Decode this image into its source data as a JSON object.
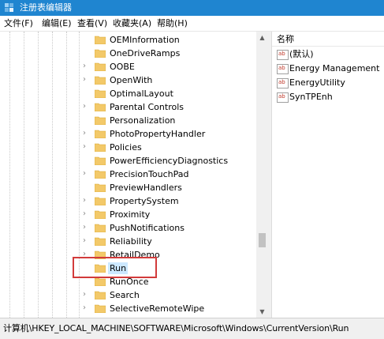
{
  "window": {
    "title": "注册表编辑器"
  },
  "menu": [
    {
      "label": "文件(F)"
    },
    {
      "label": "编辑(E)"
    },
    {
      "label": "查看(V)"
    },
    {
      "label": "收藏夹(A)"
    },
    {
      "label": "帮助(H)"
    }
  ],
  "tree": {
    "items": [
      {
        "label": "OEMInformation",
        "expandable": false,
        "selected": false
      },
      {
        "label": "OneDriveRamps",
        "expandable": false,
        "selected": false
      },
      {
        "label": "OOBE",
        "expandable": true,
        "selected": false
      },
      {
        "label": "OpenWith",
        "expandable": true,
        "selected": false
      },
      {
        "label": "OptimalLayout",
        "expandable": false,
        "selected": false
      },
      {
        "label": "Parental Controls",
        "expandable": true,
        "selected": false
      },
      {
        "label": "Personalization",
        "expandable": false,
        "selected": false
      },
      {
        "label": "PhotoPropertyHandler",
        "expandable": true,
        "selected": false
      },
      {
        "label": "Policies",
        "expandable": true,
        "selected": false
      },
      {
        "label": "PowerEfficiencyDiagnostics",
        "expandable": false,
        "selected": false
      },
      {
        "label": "PrecisionTouchPad",
        "expandable": true,
        "selected": false
      },
      {
        "label": "PreviewHandlers",
        "expandable": false,
        "selected": false
      },
      {
        "label": "PropertySystem",
        "expandable": true,
        "selected": false
      },
      {
        "label": "Proximity",
        "expandable": true,
        "selected": false
      },
      {
        "label": "PushNotifications",
        "expandable": true,
        "selected": false
      },
      {
        "label": "Reliability",
        "expandable": true,
        "selected": false
      },
      {
        "label": "RetailDemo",
        "expandable": true,
        "selected": false
      },
      {
        "label": "Run",
        "expandable": false,
        "selected": true
      },
      {
        "label": "RunOnce",
        "expandable": false,
        "selected": false
      },
      {
        "label": "Search",
        "expandable": true,
        "selected": false
      },
      {
        "label": "SelectiveRemoteWipe",
        "expandable": true,
        "selected": false
      }
    ]
  },
  "values": {
    "header": "名称",
    "rows": [
      {
        "name": "(默认)",
        "type_icon": "ab"
      },
      {
        "name": "Energy Management",
        "type_icon": "ab"
      },
      {
        "name": "EnergyUtility",
        "type_icon": "ab"
      },
      {
        "name": "SynTPEnh",
        "type_icon": "ab"
      }
    ]
  },
  "status": {
    "path": "计算机\\HKEY_LOCAL_MACHINE\\SOFTWARE\\Microsoft\\Windows\\CurrentVersion\\Run"
  },
  "colors": {
    "titlebar": "#1f85d0",
    "folder": "#f3c969",
    "highlight": "#d23b3b",
    "selection": "#cce8ff"
  },
  "icons": {
    "app": "registry-editor-icon",
    "folder": "folder-icon",
    "expand": "chevron-right-icon",
    "string_value": "string-value-icon"
  }
}
